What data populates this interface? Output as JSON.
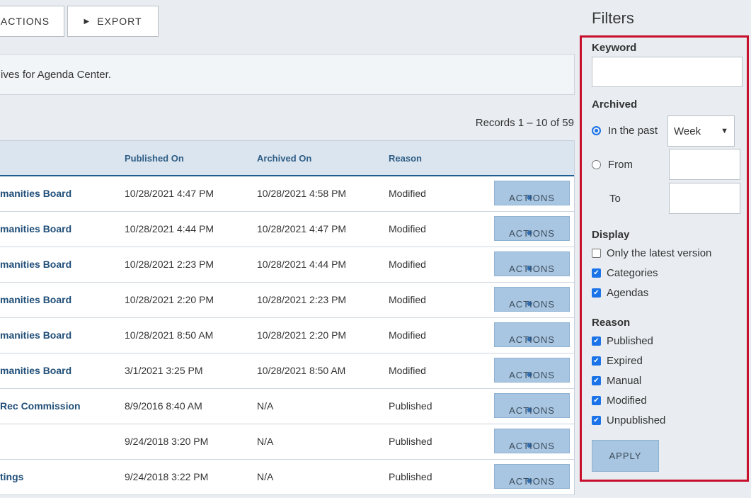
{
  "toolbar": {
    "actions_label": "ACTIONS",
    "export_label": "EXPORT"
  },
  "notice": "ives for Agenda Center.",
  "records": "Records 1 – 10 of 59",
  "table": {
    "headers": {
      "published_on": "Published On",
      "archived_on": "Archived On",
      "reason": "Reason"
    },
    "action_label": "ACTIONS",
    "rows": [
      {
        "name": "manities Board",
        "published": "10/28/2021 4:47 PM",
        "archived": "10/28/2021 4:58 PM",
        "reason": "Modified"
      },
      {
        "name": "manities Board",
        "published": "10/28/2021 4:44 PM",
        "archived": "10/28/2021 4:47 PM",
        "reason": "Modified"
      },
      {
        "name": "manities Board",
        "published": "10/28/2021 2:23 PM",
        "archived": "10/28/2021 4:44 PM",
        "reason": "Modified"
      },
      {
        "name": "manities Board",
        "published": "10/28/2021 2:20 PM",
        "archived": "10/28/2021 2:23 PM",
        "reason": "Modified"
      },
      {
        "name": "manities Board",
        "published": "10/28/2021 8:50 AM",
        "archived": "10/28/2021 2:20 PM",
        "reason": "Modified"
      },
      {
        "name": "manities Board",
        "published": "3/1/2021 3:25 PM",
        "archived": "10/28/2021 8:50 AM",
        "reason": "Modified"
      },
      {
        "name": "Rec Commission",
        "published": "8/9/2016 8:40 AM",
        "archived": "N/A",
        "reason": "Published"
      },
      {
        "name": "",
        "published": "9/24/2018 3:20 PM",
        "archived": "N/A",
        "reason": "Published"
      },
      {
        "name": "tings",
        "published": "9/24/2018 3:22 PM",
        "archived": "N/A",
        "reason": "Published"
      }
    ]
  },
  "filters": {
    "title": "Filters",
    "keyword_label": "Keyword",
    "archived_label": "Archived",
    "in_the_past_label": "In the past",
    "period_value": "Week",
    "from_label": "From",
    "to_label": "To",
    "display_label": "Display",
    "display_options": [
      {
        "label": "Only the latest version",
        "checked": false
      },
      {
        "label": "Categories",
        "checked": true
      },
      {
        "label": "Agendas",
        "checked": true
      }
    ],
    "reason_label": "Reason",
    "reason_options": [
      {
        "label": "Published",
        "checked": true
      },
      {
        "label": "Expired",
        "checked": true
      },
      {
        "label": "Manual",
        "checked": true
      },
      {
        "label": "Modified",
        "checked": true
      },
      {
        "label": "Unpublished",
        "checked": true
      }
    ],
    "apply_label": "APPLY"
  },
  "colors": {
    "accent": "#1a73e8",
    "highlight_border": "#c8102e",
    "header_bg": "#dbe5ef",
    "button_bg": "#a8c6e2"
  }
}
